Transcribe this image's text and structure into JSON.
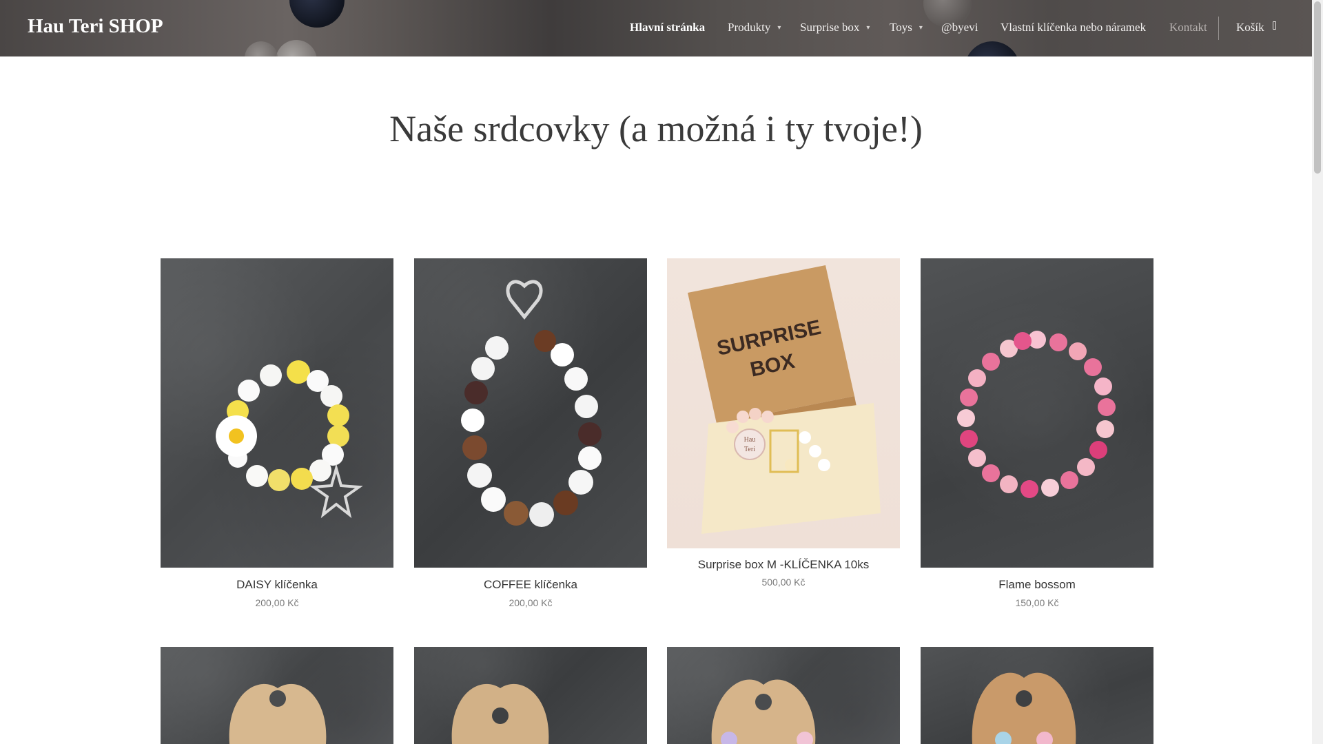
{
  "header": {
    "logo": "Hau Teri SHOP",
    "nav": [
      {
        "label": "Hlavní stránka",
        "active": true,
        "dropdown": false
      },
      {
        "label": "Produkty",
        "active": false,
        "dropdown": true
      },
      {
        "label": "Surprise box",
        "active": false,
        "dropdown": true
      },
      {
        "label": "Toys",
        "active": false,
        "dropdown": true
      },
      {
        "label": "@byevi",
        "active": false,
        "dropdown": false
      },
      {
        "label": "Vlastní klíčenka nebo náramek",
        "active": false,
        "dropdown": false
      },
      {
        "label": "Kontakt",
        "active": false,
        "dropdown": false
      }
    ],
    "cart_label": "Košík"
  },
  "main": {
    "title": "Naše srdcovky (a možná i ty tvoje!)"
  },
  "products": [
    {
      "name": "DAISY klíčenka",
      "price": "200,00 Kč"
    },
    {
      "name": "COFFEE klíčenka",
      "price": "200,00 Kč"
    },
    {
      "name": "Surprise box M -KLÍČENKA 10ks",
      "price": "500,00 Kč",
      "box_text_1": "SURPRISE",
      "box_text_2": "BOX",
      "seal_text_1": "Hau",
      "seal_text_2": "Teri"
    },
    {
      "name": "Flame bossom",
      "price": "150,00 Kč"
    }
  ],
  "colors": {
    "title": "#3a3a3a",
    "product_name": "#333333",
    "price": "#7a7a7a"
  }
}
